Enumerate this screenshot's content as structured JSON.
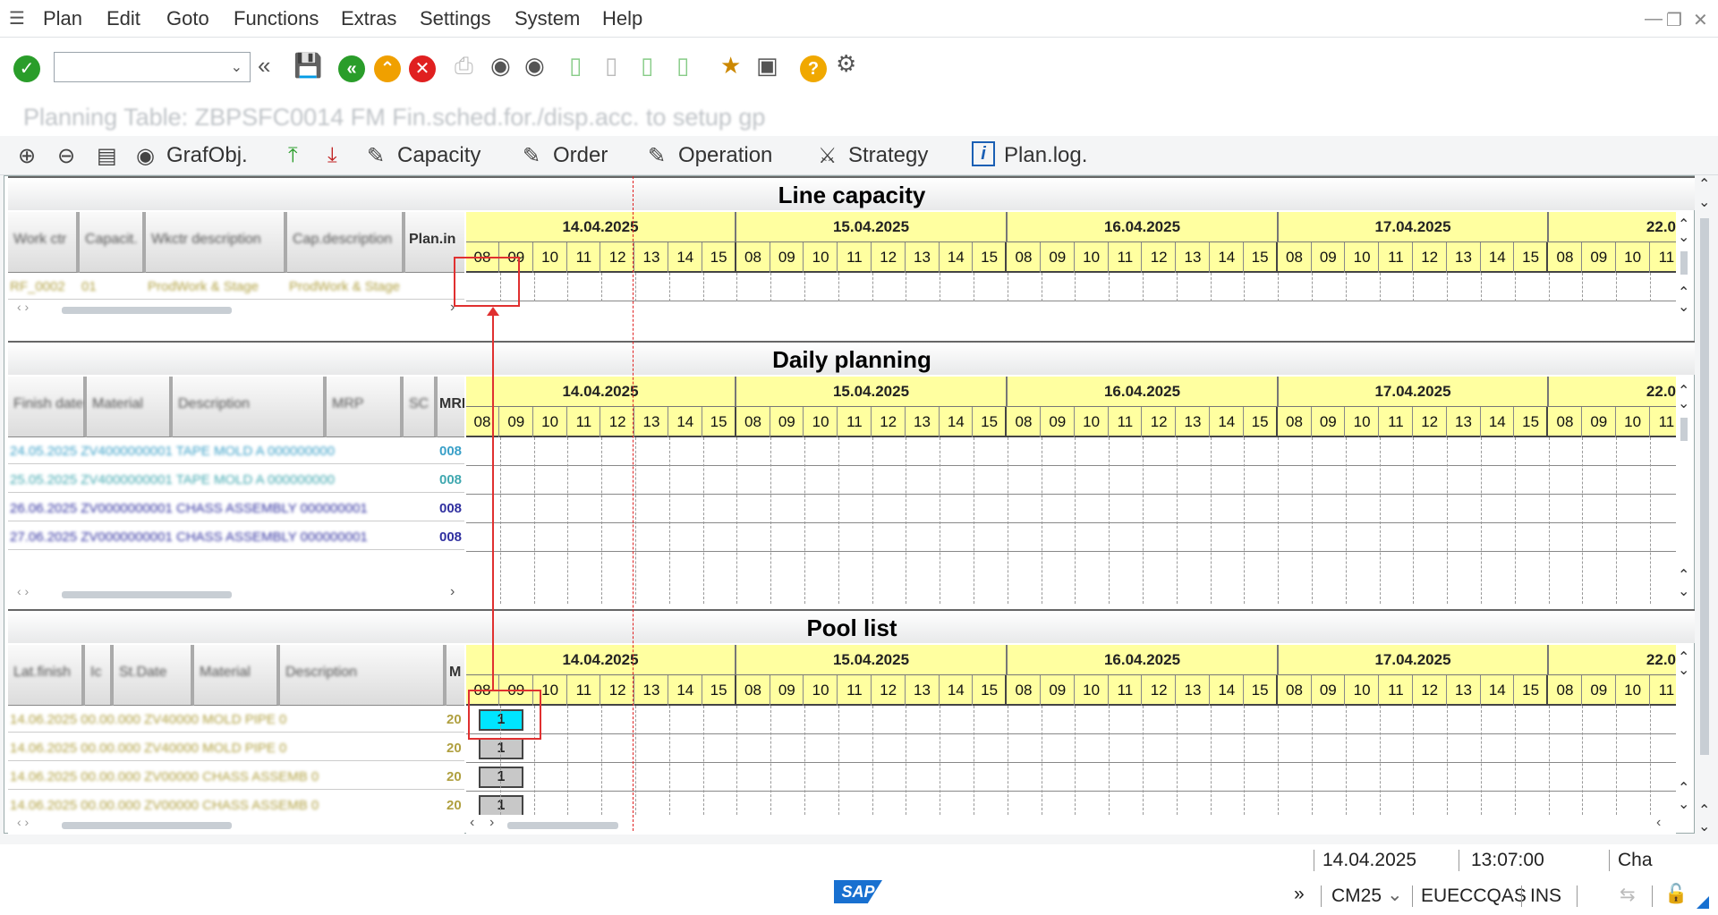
{
  "menu": {
    "items": [
      "Plan",
      "Edit",
      "Goto",
      "Functions",
      "Extras",
      "Settings",
      "System",
      "Help"
    ]
  },
  "toolbar": {
    "command_value": ""
  },
  "title": "Planning Table: ZBPSFC0014 FM Fin.sched.for./disp.acc. to setup gp",
  "app_toolbar": {
    "grafobj": "GrafObj.",
    "capacity": "Capacity",
    "order": "Order",
    "operation": "Operation",
    "strategy": "Strategy",
    "planlog": "Plan.log."
  },
  "dates": [
    "14.04.2025",
    "15.04.2025",
    "16.04.2025",
    "17.04.2025",
    "22.0"
  ],
  "hours": [
    "08",
    "09",
    "10",
    "11",
    "12",
    "13",
    "14",
    "15",
    "1"
  ],
  "sections": {
    "line_capacity": {
      "title": "Line capacity",
      "columns": [
        "Work ctr",
        "Capacit.",
        "Wkctr description",
        "Cap.description",
        "Plan.in"
      ],
      "rows": [
        [
          "RF_0002",
          "01",
          "ProdWork & Stage",
          "ProdWork & Stage"
        ]
      ]
    },
    "daily_planning": {
      "title": "Daily planning",
      "columns": [
        "Finish date",
        "Material",
        "Description",
        "MRP",
        "SC",
        "MRP"
      ],
      "rows": [
        {
          "text": "24.05.2025 ZV4000000001 TAPE MOLD A 000000000",
          "tail": "008"
        },
        {
          "text": "25.05.2025 ZV4000000001 TAPE MOLD A 000000000",
          "tail": "008"
        },
        {
          "text": "26.06.2025 ZV0000000001 CHASS ASSEMBLY 000000001",
          "tail": "008"
        },
        {
          "text": "27.06.2025 ZV0000000001 CHASS ASSEMBLY 000000001",
          "tail": "008"
        }
      ]
    },
    "pool_list": {
      "title": "Pool list",
      "columns": [
        "Lat.finish",
        "Ic",
        "St.Date",
        "Material",
        "Description",
        "M"
      ],
      "rows": [
        {
          "text": "14.06.2025 00.00.000 ZV40000 MOLD PIPE 0",
          "tail": "20",
          "count": "1",
          "selected": true
        },
        {
          "text": "14.06.2025 00.00.000 ZV40000 MOLD PIPE 0",
          "tail": "20",
          "count": "1",
          "selected": false
        },
        {
          "text": "14.06.2025 00.00.000 ZV00000 CHASS ASSEMB 0",
          "tail": "20",
          "count": "1",
          "selected": false
        },
        {
          "text": "14.06.2025 00.00.000 ZV00000 CHASS ASSEMB 0",
          "tail": "20",
          "count": "1",
          "selected": false
        }
      ]
    }
  },
  "status": {
    "date": "14.04.2025",
    "time": "13:07:00",
    "cha": "Cha",
    "transaction": "CM25",
    "system": "EUECCQAS",
    "mode": "INS",
    "logo": "SAP"
  },
  "colors": {
    "gantt_header": "#ffffa0",
    "selected_bar": "#00e5ff",
    "pool_bar": "#c8c8c8",
    "marker": "#e03030"
  }
}
